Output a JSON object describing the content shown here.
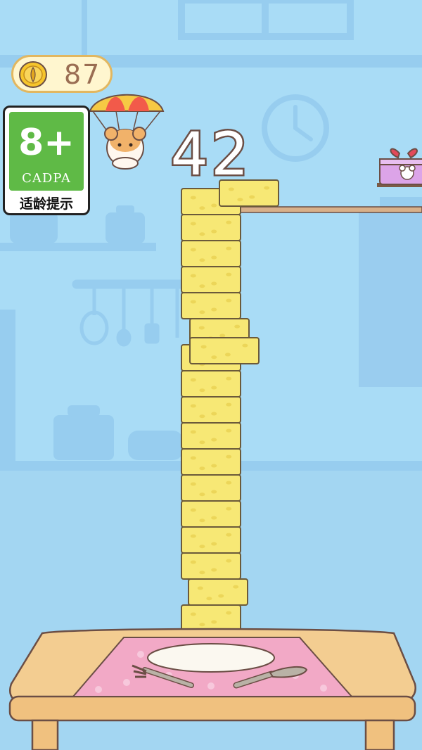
{
  "hud": {
    "coin_count": "87",
    "score": "42"
  },
  "age_badge": {
    "rating": "8+",
    "org": "CADPA",
    "caption": "适龄提示"
  },
  "tower": {
    "stacked_count": 18
  },
  "icons": [
    "coin-icon",
    "parachute-hamster-icon",
    "clock-icon",
    "gift-box-icon",
    "fork-icon",
    "knife-icon"
  ],
  "colors": {
    "sky": "#a9dcf6",
    "cheese": "#f7e875",
    "cheese_outline": "#6b5a3a",
    "tablecloth": "#f2a9c6",
    "table": "#f3cd91",
    "age_green": "#5fba46"
  }
}
